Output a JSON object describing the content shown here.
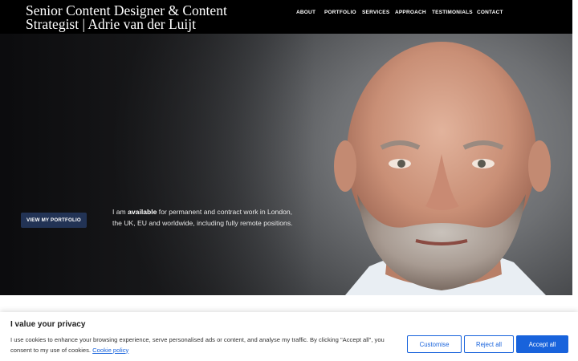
{
  "header": {
    "title": "Senior Content Designer & Content Strategist | Adrie van der Luijt",
    "nav": {
      "about": "ABOUT",
      "portfolio": "PORTFOLIO",
      "services": "SERVICES",
      "approach": "APPROACH",
      "testimonials": "TESTIMONIALS",
      "contact": "CONTACT"
    }
  },
  "hero": {
    "button_label": "VIEW MY PORTFOLIO",
    "text_before": "I am ",
    "text_bold": "available",
    "text_after": " for permanent and contract work in London, the UK, EU and worldwide, including fully remote positions."
  },
  "cookie": {
    "title": "I value your privacy",
    "text": "I use cookies to enhance your browsing experience, serve personalised ads or content, and analyse my traffic. By clicking \"Accept all\", you consent to my use of cookies. ",
    "link": "Cookie policy",
    "customise": "Customise",
    "reject": "Reject all",
    "accept": "Accept all"
  },
  "colors": {
    "header_bg": "#000000",
    "button_navy": "#223355",
    "cookie_blue": "#1863dc"
  }
}
